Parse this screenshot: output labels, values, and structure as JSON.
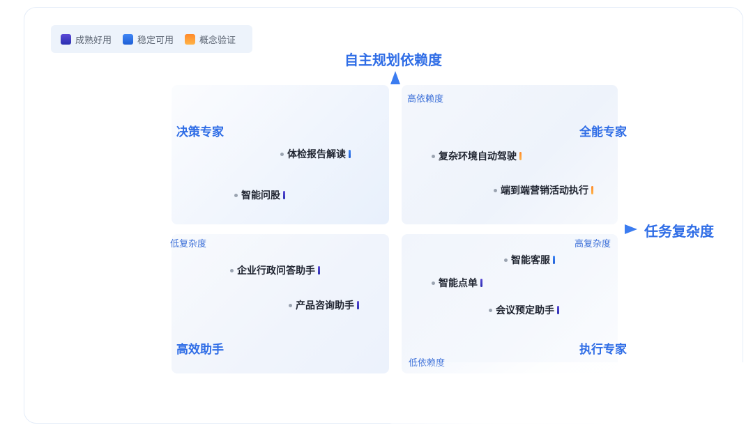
{
  "legend": [
    {
      "label": "成熟好用",
      "color_top": "#5b49d6",
      "color_bottom": "#2a2fb0"
    },
    {
      "label": "稳定可用",
      "color_top": "#3f86f5",
      "color_bottom": "#1f5fd6"
    },
    {
      "label": "概念验证",
      "color_top": "#ff8a2a",
      "color_bottom": "#ffb347"
    }
  ],
  "axes": {
    "y_title": "自主规划依赖度",
    "x_title": "任务复杂度",
    "y_high": "高依赖度",
    "y_low": "低依赖度",
    "x_low": "低复杂度",
    "x_high": "高复杂度",
    "color": "#3b7cf0"
  },
  "quadrants": {
    "top_left": "决策专家",
    "top_right": "全能专家",
    "bottom_left": "高效助手",
    "bottom_right": "执行专家"
  },
  "items": [
    {
      "label": "体检报告解读",
      "quadrant": "top_left",
      "maturity": "稳定可用"
    },
    {
      "label": "智能问股",
      "quadrant": "top_left",
      "maturity": "成熟好用"
    },
    {
      "label": "复杂环境自动驾驶",
      "quadrant": "top_right",
      "maturity": "概念验证"
    },
    {
      "label": "端到端营销活动执行",
      "quadrant": "top_right",
      "maturity": "概念验证"
    },
    {
      "label": "企业行政问答助手",
      "quadrant": "bottom_left",
      "maturity": "成熟好用"
    },
    {
      "label": "产品咨询助手",
      "quadrant": "bottom_left",
      "maturity": "成熟好用"
    },
    {
      "label": "智能客服",
      "quadrant": "bottom_right",
      "maturity": "稳定可用"
    },
    {
      "label": "智能点单",
      "quadrant": "bottom_right",
      "maturity": "成熟好用"
    },
    {
      "label": "会议预定助手",
      "quadrant": "bottom_right",
      "maturity": "成熟好用"
    }
  ]
}
